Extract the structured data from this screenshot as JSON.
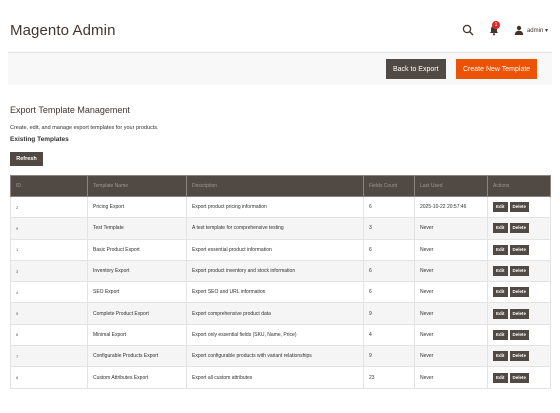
{
  "header": {
    "title": "Magento Admin",
    "notification_count": "1",
    "user_label": "admin ▾"
  },
  "actions": {
    "back_label": "Back to Export",
    "create_label": "Create New Template"
  },
  "section": {
    "title": "Export Template Management",
    "description": "Create, edit, and manage export templates for your products.",
    "subtitle": "Existing Templates",
    "refresh_label": "Refresh"
  },
  "table": {
    "columns": [
      "ID",
      "Template Name",
      "Description",
      "Fields Count",
      "Last Used",
      "Actions"
    ],
    "rows": [
      {
        "id": "2",
        "name": "Pricing Export",
        "description": "Export product pricing information",
        "fields": "6",
        "last_used": "2025-10-22 20:57:46"
      },
      {
        "id": "9",
        "name": "Test Template",
        "description": "A test template for comprehensive testing",
        "fields": "3",
        "last_used": "Never"
      },
      {
        "id": "1",
        "name": "Basic Product Export",
        "description": "Export essential product information",
        "fields": "6",
        "last_used": "Never"
      },
      {
        "id": "3",
        "name": "Inventory Export",
        "description": "Export product inventory and stock information",
        "fields": "6",
        "last_used": "Never"
      },
      {
        "id": "4",
        "name": "SEO Export",
        "description": "Export SEO and URL information",
        "fields": "6",
        "last_used": "Never"
      },
      {
        "id": "5",
        "name": "Complete Product Export",
        "description": "Export comprehensive product data",
        "fields": "9",
        "last_used": "Never"
      },
      {
        "id": "6",
        "name": "Minimal Export",
        "description": "Export only essential fields (SKU, Name, Price)",
        "fields": "4",
        "last_used": "Never"
      },
      {
        "id": "7",
        "name": "Configurable Products Export",
        "description": "Export configurable products with variant relationships",
        "fields": "9",
        "last_used": "Never"
      },
      {
        "id": "8",
        "name": "Custom Attributes Export",
        "description": "Export all custom attributes",
        "fields": "23",
        "last_used": "Never"
      }
    ],
    "edit_label": "Edit",
    "delete_label": "Delete"
  },
  "colors": {
    "accent": "#eb5202",
    "dark_button": "#514943",
    "header_bg": "#514943"
  }
}
